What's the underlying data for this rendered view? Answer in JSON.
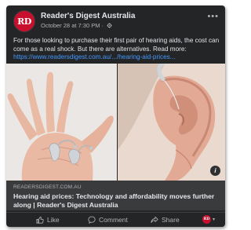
{
  "post": {
    "page_name": "Reader's Digest Australia",
    "avatar_text": "RD",
    "timestamp": "October 28 at 7:30 PM",
    "separator": "·",
    "text": "For those looking to purchase their first pair of hearing aids, the cost can come as a real shock. But there are alternatives. Read more:",
    "link_text": "https://www.readersdigest.com.au/.../hearing-aid-prices...",
    "more_label": "•••"
  },
  "link_preview": {
    "domain": "READERSDIGEST.COM.AU",
    "headline": "Hearing aid prices: Technology and affordability moves further along | Reader's Digest Australia",
    "info_label": "i"
  },
  "actions": {
    "like": "Like",
    "comment": "Comment",
    "share": "Share",
    "reactor_avatar_text": "RD",
    "reactor_caret": "▾"
  },
  "colors": {
    "card_bg": "#242526",
    "link": "#4599ff",
    "brand_red": "#c8102e"
  }
}
